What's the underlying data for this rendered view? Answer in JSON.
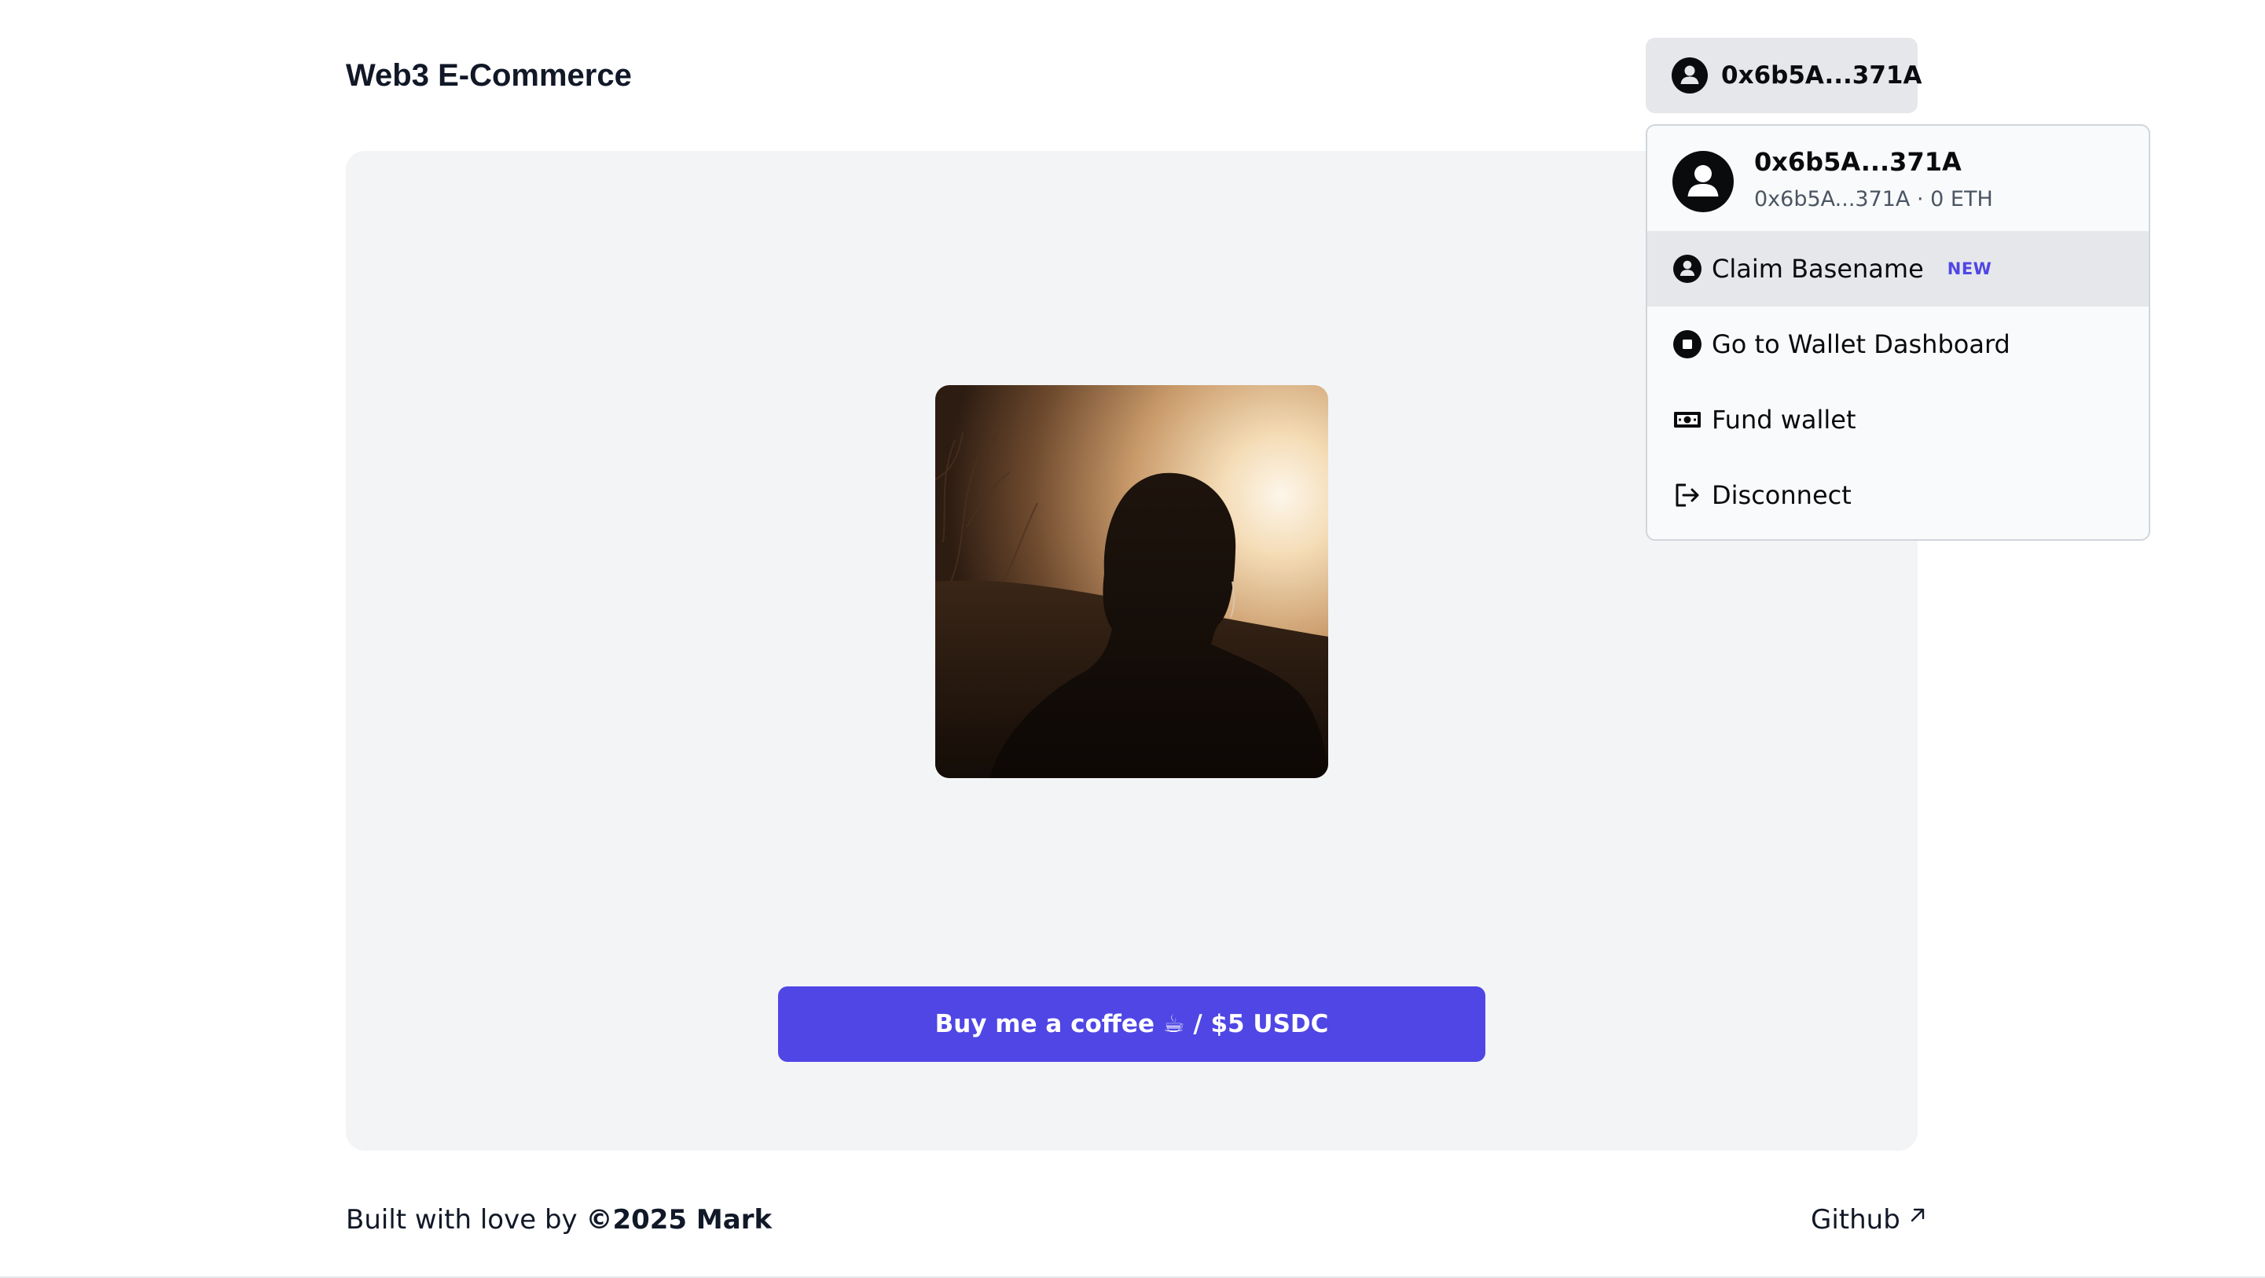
{
  "header": {
    "title": "Web3 E-Commerce",
    "wallet_address": "0x6b5A...371A",
    "avatar_icon": "user-circle-icon"
  },
  "dropdown": {
    "name": "0x6b5A...371A",
    "subtitle": "0x6b5A...371A · 0 ETH",
    "items": [
      {
        "label": "Claim Basename",
        "badge": "NEW",
        "icon": "user-circle-icon"
      },
      {
        "label": "Go to Wallet Dashboard",
        "icon": "wallet-dashboard-icon"
      },
      {
        "label": "Fund wallet",
        "icon": "cash-icon"
      },
      {
        "label": "Disconnect",
        "icon": "logout-icon"
      }
    ]
  },
  "main": {
    "image_alt": "Silhouette of a person against the sunset",
    "buy_button_label": "Buy me a coffee ☕ / $5 USDC"
  },
  "footer": {
    "built_prefix": "Built with love by ",
    "built_author": "©2025 Mark",
    "github_label": "Github"
  },
  "colors": {
    "accent": "#4f46e5",
    "card_bg": "#f3f4f6",
    "wallet_button_bg": "#e5e7eb",
    "text": "#111827"
  }
}
